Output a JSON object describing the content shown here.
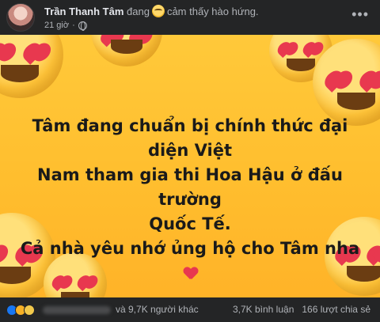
{
  "header": {
    "author": "Trần Thanh Tâm",
    "status_prefix": "đang",
    "feeling_icon": "grinning-face-icon",
    "status_text": "cảm thấy hào hứng.",
    "time": "21 giờ",
    "privacy_icon": "globe-icon",
    "more_icon": "more-options-icon"
  },
  "image": {
    "caption_lines": [
      "Tâm đang chuẩn bị chính thức đại diện Việt",
      "Nam tham gia thi Hoa Hậu ở đấu trường",
      "Quốc Tế.",
      "Cả nhà yêu nhớ ủng hộ cho Tâm nha"
    ],
    "background_color": "#ffc131",
    "decoration_icon": "heart-eyes-emoji-icon",
    "heart_icon": "red-heart-icon"
  },
  "footer": {
    "reaction_icons": [
      "like-icon",
      "haha-icon",
      "sad-icon"
    ],
    "others": "và 9,7K người khác",
    "comments": "3,7K bình luận",
    "shares": "166 lượt chia sẻ"
  },
  "colors": {
    "background": "#242526",
    "text_primary": "#e4e6eb",
    "text_secondary": "#b0b3b8",
    "heart": "#e8384f"
  }
}
